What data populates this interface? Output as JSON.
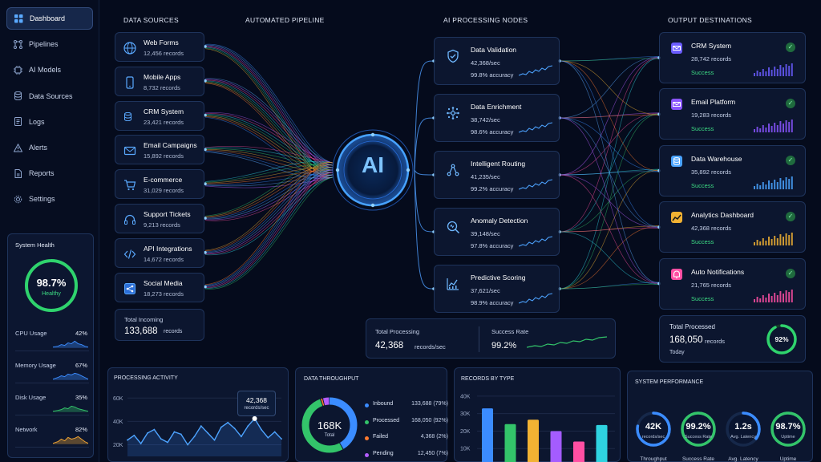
{
  "nav": [
    {
      "label": "Dashboard",
      "icon": "dashboard-icon",
      "active": true
    },
    {
      "label": "Pipelines",
      "icon": "pipelines-icon"
    },
    {
      "label": "AI Models",
      "icon": "ai-models-icon"
    },
    {
      "label": "Data Sources",
      "icon": "database-icon"
    },
    {
      "label": "Logs",
      "icon": "logs-icon"
    },
    {
      "label": "Alerts",
      "icon": "alert-icon"
    },
    {
      "label": "Reports",
      "icon": "reports-icon"
    },
    {
      "label": "Settings",
      "icon": "gear-icon"
    }
  ],
  "system_health": {
    "title": "System Health",
    "value": "98.7%",
    "status": "Healthy",
    "fill": 0.987,
    "metrics": [
      {
        "label": "CPU Usage",
        "value": "42%"
      },
      {
        "label": "Memory Usage",
        "value": "67%"
      },
      {
        "label": "Disk Usage",
        "value": "35%"
      },
      {
        "label": "Network",
        "value": "82%"
      }
    ]
  },
  "headers": {
    "sources": "DATA SOURCES",
    "pipeline": "AUTOMATED PIPELINE",
    "nodes": "AI PROCESSING NODES",
    "outputs": "OUTPUT DESTINATIONS"
  },
  "sources": [
    {
      "name": "Web Forms",
      "records": "12,456 records",
      "icon": "globe-icon"
    },
    {
      "name": "Mobile Apps",
      "records": "8,732 records",
      "icon": "mobile-icon"
    },
    {
      "name": "CRM System",
      "records": "23,421 records",
      "icon": "database-icon"
    },
    {
      "name": "Email Campaigns",
      "records": "15,892 records",
      "icon": "mail-icon"
    },
    {
      "name": "E-commerce",
      "records": "31,029 records",
      "icon": "cart-icon"
    },
    {
      "name": "Support Tickets",
      "records": "9,213 records",
      "icon": "headset-icon"
    },
    {
      "name": "API Integrations",
      "records": "14,672 records",
      "icon": "code-icon"
    },
    {
      "name": "Social Media",
      "records": "18,273 records",
      "icon": "share-icon"
    }
  ],
  "total_incoming": {
    "label": "Total Incoming",
    "value": "133,688",
    "unit": "records"
  },
  "ai_core": {
    "label": "AI"
  },
  "nodes": [
    {
      "name": "Data Validation",
      "rate": "42,368/sec",
      "accuracy": "99.8% accuracy",
      "icon": "shield-check-icon"
    },
    {
      "name": "Data Enrichment",
      "rate": "38,742/sec",
      "accuracy": "98.6% accuracy",
      "icon": "network-icon"
    },
    {
      "name": "Intelligent Routing",
      "rate": "41,235/sec",
      "accuracy": "99.2% accuracy",
      "icon": "routing-icon"
    },
    {
      "name": "Anomaly Detection",
      "rate": "39,148/sec",
      "accuracy": "97.8% accuracy",
      "icon": "search-icon"
    },
    {
      "name": "Predictive Scoring",
      "rate": "37,621/sec",
      "accuracy": "98.9% accuracy",
      "icon": "chart-icon"
    }
  ],
  "processing_summary": {
    "total_label": "Total Processing",
    "total_value": "42,368",
    "total_unit": "records/sec",
    "success_label": "Success Rate",
    "success_value": "99.2%"
  },
  "outputs": [
    {
      "name": "CRM System",
      "records": "28,742 records",
      "status": "Success",
      "color": "#6a5cff",
      "icon": "mail-icon"
    },
    {
      "name": "Email Platform",
      "records": "19,283 records",
      "status": "Success",
      "color": "#8a55ff",
      "icon": "mail-icon"
    },
    {
      "name": "Data Warehouse",
      "records": "35,892 records",
      "status": "Success",
      "color": "#4aa3ff",
      "icon": "database-icon"
    },
    {
      "name": "Analytics Dashboard",
      "records": "42,368 records",
      "status": "Success",
      "color": "#f2b233",
      "icon": "analytics-icon"
    },
    {
      "name": "Auto Notifications",
      "records": "21,765 records",
      "status": "Success",
      "color": "#ff4fa3",
      "icon": "bell-icon"
    }
  ],
  "total_processed": {
    "label": "Total Processed",
    "value": "168,050",
    "unit": "records",
    "sub": "Today",
    "percent": "92%",
    "fill": 0.92
  },
  "processing_activity": {
    "title": "PROCESSING ACTIVITY",
    "callout_value": "42,368",
    "callout_unit": "records/sec"
  },
  "data_throughput": {
    "title": "DATA THROUGHPUT",
    "center_value": "168K",
    "center_label": "Total",
    "legend": [
      {
        "name": "Inbound",
        "value": "133,688 (79%)",
        "color": "#3b8cff"
      },
      {
        "name": "Processed",
        "value": "168,050 (92%)",
        "color": "#33c46a"
      },
      {
        "name": "Failed",
        "value": "4,368 (2%)",
        "color": "#ff7a2f"
      },
      {
        "name": "Pending",
        "value": "12,450 (7%)",
        "color": "#b45cff"
      }
    ]
  },
  "records_by_type": {
    "title": "RECORDS BY TYPE"
  },
  "system_performance": {
    "title": "SYSTEM PERFORMANCE",
    "gauges": [
      {
        "value": "42K",
        "sub": "records/sec",
        "label": "Throughput",
        "color": "#3b8cff",
        "fill": 0.78
      },
      {
        "value": "99.2%",
        "sub": "Success Rate",
        "label": "Success Rate",
        "color": "#33c46a",
        "fill": 0.992
      },
      {
        "value": "1.2s",
        "sub": "Avg. Latency",
        "label": "Avg. Latency",
        "color": "#3b8cff",
        "fill": 0.35
      },
      {
        "value": "98.7%",
        "sub": "Uptime",
        "label": "Uptime",
        "color": "#33c46a",
        "fill": 0.987
      }
    ]
  },
  "chart_data": [
    {
      "type": "line",
      "title": "PROCESSING ACTIVITY",
      "y_ticks": [
        "60K",
        "40K",
        "20K"
      ],
      "ylim": [
        10000,
        65000
      ],
      "values": [
        24000,
        28000,
        21000,
        30000,
        33000,
        25000,
        22000,
        31000,
        29000,
        20000,
        27000,
        36000,
        30000,
        24000,
        35000,
        39000,
        34000,
        27000,
        36000,
        42368,
        33000,
        26000,
        31000,
        25000
      ],
      "highlight_index": 19
    },
    {
      "type": "pie",
      "title": "DATA THROUGHPUT",
      "labels": [
        "Inbound",
        "Processed",
        "Failed",
        "Pending"
      ],
      "values": [
        133688,
        168050,
        4368,
        12450
      ]
    },
    {
      "type": "bar",
      "title": "RECORDS BY TYPE",
      "y_ticks": [
        "40K",
        "30K",
        "20K",
        "10K"
      ],
      "ylim": [
        0,
        45000
      ],
      "values": [
        33000,
        24000,
        26500,
        20000,
        14000,
        23500
      ],
      "colors": [
        "#3b8cff",
        "#33c46a",
        "#f2b233",
        "#a45cff",
        "#ff4fa3",
        "#2fd3e0"
      ]
    }
  ]
}
